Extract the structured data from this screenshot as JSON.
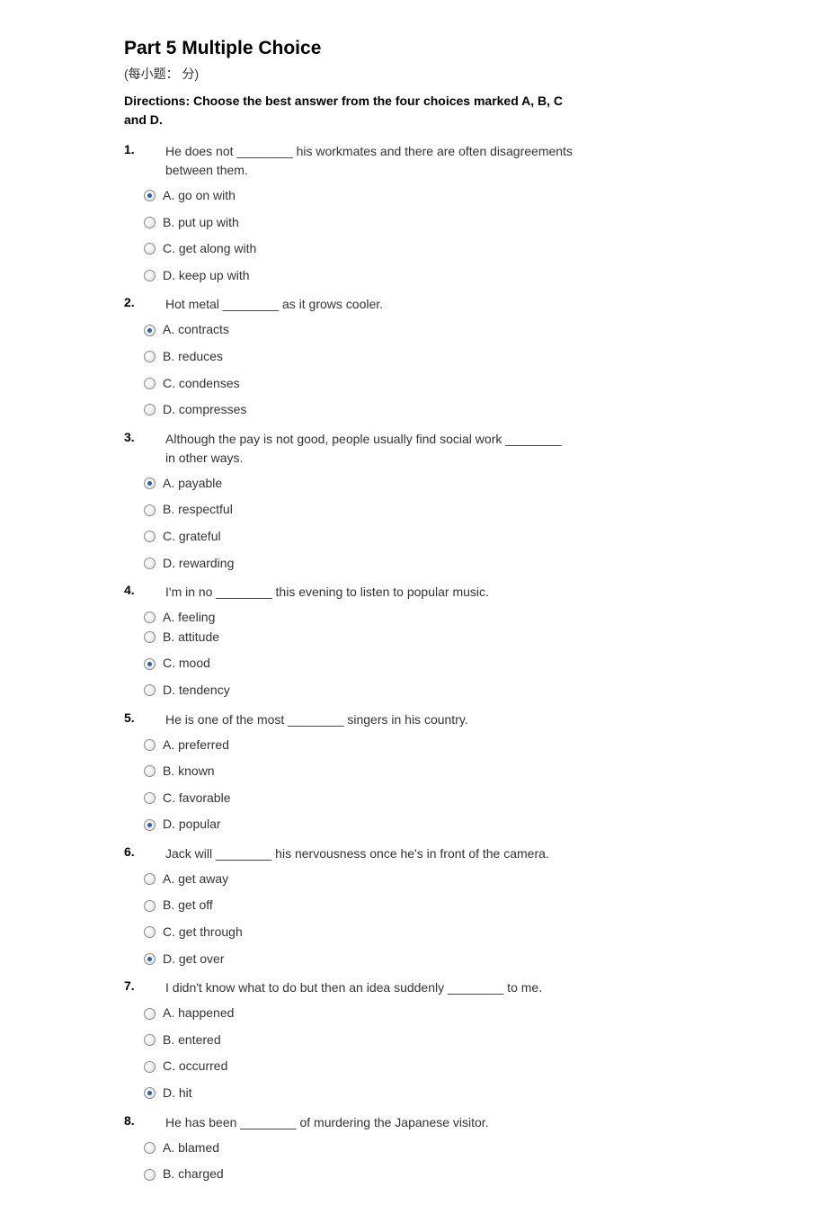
{
  "title": "Part 5 Multiple Choice",
  "subtitle": "(每小题：  分)",
  "directions": "Directions: Choose the best answer from the four choices marked A, B, C and D.",
  "questions": [
    {
      "num": "1.",
      "text": "He does not ________ his workmates and there are often disagreements between them.",
      "options": [
        {
          "label": "A. go on with",
          "selected": true
        },
        {
          "label": "B. put up with",
          "selected": false
        },
        {
          "label": "C. get along with",
          "selected": false
        },
        {
          "label": "D. keep up with",
          "selected": false
        }
      ]
    },
    {
      "num": "2.",
      "text": "Hot metal ________ as it grows cooler.",
      "options": [
        {
          "label": "A. contracts",
          "selected": true
        },
        {
          "label": "B. reduces",
          "selected": false
        },
        {
          "label": "C. condenses",
          "selected": false
        },
        {
          "label": "D. compresses",
          "selected": false
        }
      ]
    },
    {
      "num": "3.",
      "text": "Although the pay is not good, people usually find social work ________ in other ways.",
      "options": [
        {
          "label": "A. payable",
          "selected": true
        },
        {
          "label": "B. respectful",
          "selected": false
        },
        {
          "label": "C. grateful",
          "selected": false
        },
        {
          "label": "D. rewarding",
          "selected": false
        }
      ]
    },
    {
      "num": "4.",
      "text": "I'm in no ________ this evening to listen to popular music.",
      "options": [
        {
          "label": "A. feeling",
          "selected": false,
          "tight": true
        },
        {
          "label": "B. attitude",
          "selected": false
        },
        {
          "label": "C. mood",
          "selected": true
        },
        {
          "label": "D. tendency",
          "selected": false
        }
      ]
    },
    {
      "num": "5.",
      "text": "He is one of the most ________ singers in his country.",
      "options": [
        {
          "label": "A. preferred",
          "selected": false
        },
        {
          "label": "B. known",
          "selected": false
        },
        {
          "label": "C. favorable",
          "selected": false
        },
        {
          "label": "D. popular",
          "selected": true
        }
      ]
    },
    {
      "num": "6.",
      "text": "Jack will ________ his nervousness once he's in front of the camera.",
      "options": [
        {
          "label": "A. get away",
          "selected": false
        },
        {
          "label": "B. get off",
          "selected": false
        },
        {
          "label": "C. get through",
          "selected": false
        },
        {
          "label": "D. get over",
          "selected": true
        }
      ]
    },
    {
      "num": "7.",
      "text": "I didn't know what to do but then an idea suddenly ________ to me.",
      "options": [
        {
          "label": "A. happened",
          "selected": false
        },
        {
          "label": "B. entered",
          "selected": false
        },
        {
          "label": "C. occurred",
          "selected": false
        },
        {
          "label": "D. hit",
          "selected": true
        }
      ]
    },
    {
      "num": "8.",
      "text": "He has been ________ of murdering the Japanese visitor.",
      "options": [
        {
          "label": "A. blamed",
          "selected": false
        },
        {
          "label": "B. charged",
          "selected": false
        }
      ]
    }
  ]
}
